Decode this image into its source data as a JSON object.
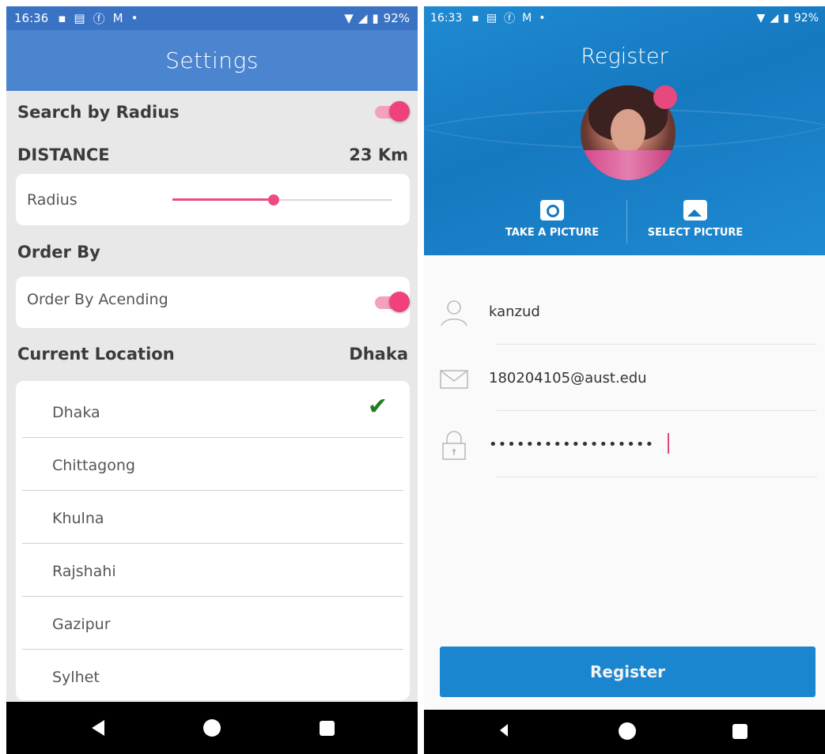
{
  "settings": {
    "status": {
      "time": "16:36",
      "battery": "92%"
    },
    "title": "Settings",
    "search_by_radius": {
      "label": "Search by Radius",
      "enabled": true
    },
    "distance": {
      "label": "DISTANCE",
      "value": "23 Km"
    },
    "radius": {
      "label": "Radius",
      "slider_fraction": 0.46
    },
    "order_by": {
      "heading": "Order By",
      "label": "Order By Acending",
      "enabled": true
    },
    "current_location": {
      "label": "Current Location",
      "value": "Dhaka"
    },
    "cities": [
      "Dhaka",
      "Chittagong",
      "Khulna",
      "Rajshahi",
      "Gazipur",
      "Sylhet"
    ],
    "selected_city_index": 0,
    "colors": {
      "appbar": "#4b84cf",
      "accent": "#f0417a",
      "check": "#1b7e1b"
    }
  },
  "register": {
    "status": {
      "time": "16:33",
      "battery": "92%"
    },
    "title": "Register",
    "take_picture": "TAKE A PICTURE",
    "select_picture": "SELECT PICTURE",
    "username": "kanzud",
    "email": "180204105@aust.edu",
    "password": "••••••••••••••••••",
    "button": "Register",
    "colors": {
      "header": "#1b86d0"
    }
  }
}
